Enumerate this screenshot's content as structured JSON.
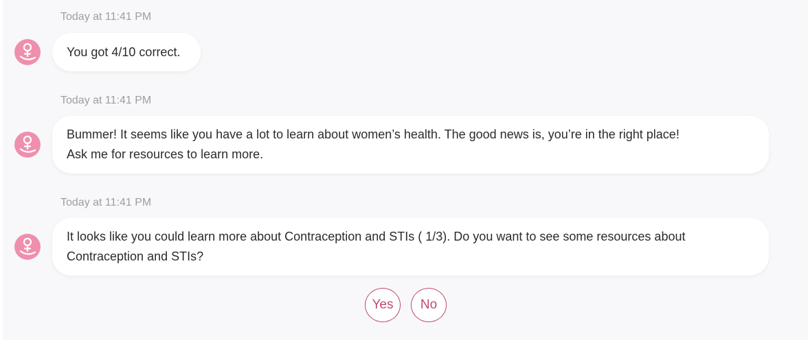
{
  "messages": [
    {
      "timestamp": "Today at 11:41 PM",
      "text": "You got 4/10 correct."
    },
    {
      "timestamp": "Today at 11:41 PM",
      "line1": "Bummer! It seems like you have a lot to learn about women’s health. The good news is, you’re in the right place!",
      "line2": "Ask me for resources to learn more."
    },
    {
      "timestamp": "Today at 11:41 PM",
      "line1": "It looks like you could learn more about Contraception and STIs ( 1/3). Do you want to see some resources about",
      "line2": "Contraception and STIs?"
    }
  ],
  "quick_replies": [
    "Yes",
    "No"
  ],
  "bot_avatar_icon": "female-symbol-hand-icon",
  "colors": {
    "panel_background": "#f8f8fa",
    "bubble_background": "#ffffff",
    "avatar_pink": "#ef8fae",
    "accent": "#c2496f",
    "timestamp_gray": "#9c9ca4"
  }
}
